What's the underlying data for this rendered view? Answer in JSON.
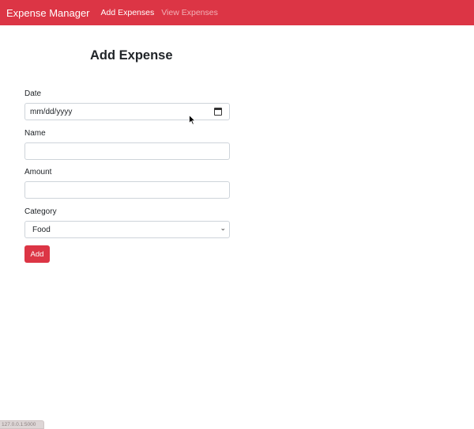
{
  "navbar": {
    "brand": "Expense Manager",
    "links": [
      {
        "label": "Add Expenses",
        "active": true
      },
      {
        "label": "View Expenses",
        "active": false
      }
    ],
    "color": "#dc3545"
  },
  "form": {
    "title": "Add Expense",
    "date": {
      "label": "Date",
      "placeholder": "mm/dd/yyyy",
      "icon": "calendar-icon"
    },
    "name": {
      "label": "Name",
      "value": ""
    },
    "amount": {
      "label": "Amount",
      "value": ""
    },
    "category": {
      "label": "Category",
      "selected": "Food",
      "icon": "chevron-down-icon"
    },
    "submit_label": "Add"
  },
  "status_bar": {
    "url": "127.0.0.1:5000"
  }
}
